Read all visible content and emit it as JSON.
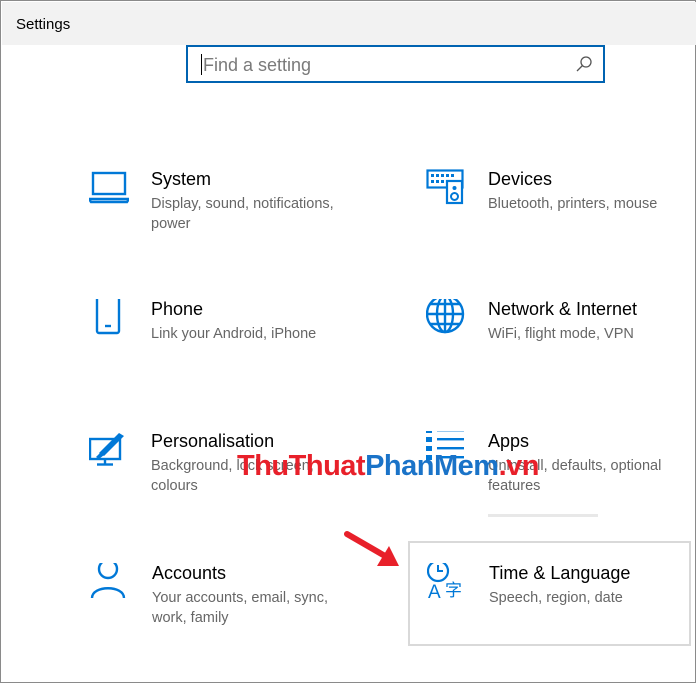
{
  "window": {
    "title": "Settings"
  },
  "search": {
    "placeholder": "Find a setting",
    "value": ""
  },
  "tiles": [
    {
      "name": "System",
      "desc": "Display, sound, notifications, power",
      "icon": "laptop-icon"
    },
    {
      "name": "Devices",
      "desc": "Bluetooth, printers, mouse",
      "icon": "keyboard-speaker-icon"
    },
    {
      "name": "Phone",
      "desc": "Link your Android, iPhone",
      "icon": "phone-icon"
    },
    {
      "name": "Network & Internet",
      "desc": "WiFi, flight mode, VPN",
      "icon": "globe-icon"
    },
    {
      "name": "Personalisation",
      "desc": "Background, lock screen, colours",
      "icon": "paintbrush-monitor-icon"
    },
    {
      "name": "Apps",
      "desc": "Uninstall, defaults, optional features",
      "icon": "apps-list-icon"
    },
    {
      "name": "Accounts",
      "desc": "Your accounts, email, sync, work, family",
      "icon": "person-icon"
    },
    {
      "name": "Time & Language",
      "desc": "Speech, region, date",
      "icon": "time-language-icon"
    }
  ],
  "watermark": {
    "part1": "ThuThuat",
    "part2": "PhanMem",
    "part3": ".vn"
  },
  "colors": {
    "accent": "#0063b1",
    "icon": "#0078d7",
    "arrow": "#e8202a",
    "description_text": "#666666"
  }
}
